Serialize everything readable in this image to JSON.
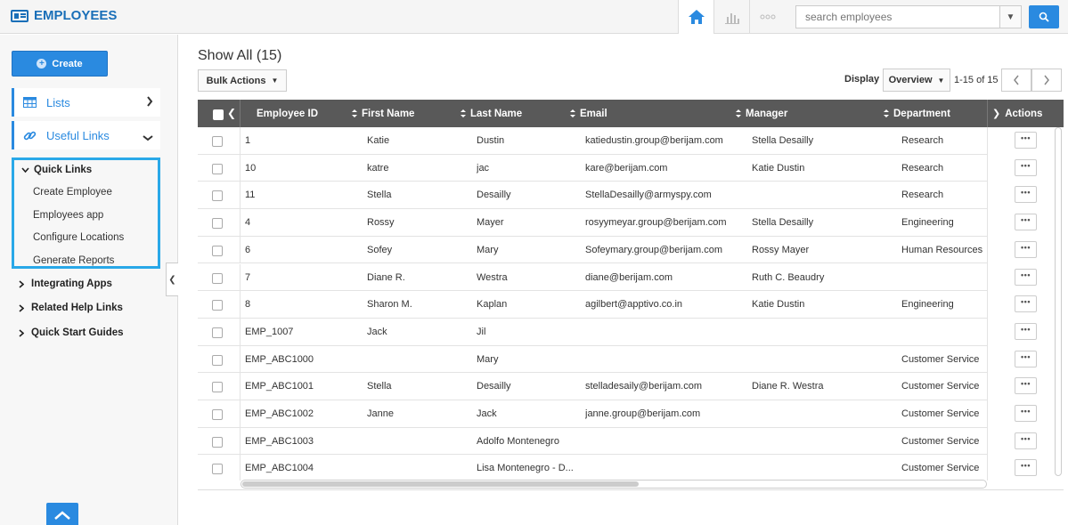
{
  "app": {
    "title": "EMPLOYEES"
  },
  "search": {
    "placeholder": "search employees"
  },
  "sidebar": {
    "create_label": "Create",
    "lists_label": "Lists",
    "useful_links_label": "Useful Links",
    "quick_links": {
      "title": "Quick Links",
      "items": [
        "Create Employee",
        "Employees app",
        "Configure Locations",
        "Generate Reports"
      ]
    },
    "groups": [
      "Integrating Apps",
      "Related Help Links",
      "Quick Start Guides"
    ]
  },
  "main": {
    "title": "Show All (15)",
    "bulk_actions": "Bulk Actions",
    "display_label": "Display",
    "display_value": "Overview",
    "pager_text": "1-15 of 15"
  },
  "table": {
    "columns": [
      "Employee ID",
      "First Name",
      "Last Name",
      "Email",
      "Manager",
      "Department",
      "Actions"
    ],
    "action_label": "•••",
    "rows": [
      [
        "1",
        "Katie",
        "Dustin",
        "katiedustin.group@berijam.com",
        "Stella Desailly",
        "Research"
      ],
      [
        "10",
        "katre",
        "jac",
        "kare@berijam.com",
        "Katie Dustin",
        "Research"
      ],
      [
        "11",
        "Stella",
        "Desailly",
        "StellaDesailly@armyspy.com",
        "",
        "Research"
      ],
      [
        "4",
        "Rossy",
        "Mayer",
        "rosyymeyar.group@berijam.com",
        "Stella Desailly",
        "Engineering"
      ],
      [
        "6",
        "Sofey",
        "Mary",
        "Sofeymary.group@berijam.com",
        "Rossy Mayer",
        "Human Resources"
      ],
      [
        "7",
        "Diane R.",
        "Westra",
        "diane@berijam.com",
        "Ruth C. Beaudry",
        ""
      ],
      [
        "8",
        "Sharon M.",
        "Kaplan",
        "agilbert@apptivo.co.in",
        "Katie Dustin",
        "Engineering"
      ],
      [
        "EMP_1007",
        "Jack",
        "Jil",
        "",
        "",
        ""
      ],
      [
        "EMP_ABC1000",
        "",
        "Mary",
        "",
        "",
        "Customer Service"
      ],
      [
        "EMP_ABC1001",
        "Stella",
        "Desailly",
        "stelladesaily@berijam.com",
        "Diane R. Westra",
        "Customer Service"
      ],
      [
        "EMP_ABC1002",
        "Janne",
        "Jack",
        "janne.group@berijam.com",
        "",
        "Customer Service"
      ],
      [
        "EMP_ABC1003",
        "",
        "Adolfo Montenegro",
        "",
        "",
        "Customer Service"
      ],
      [
        "EMP_ABC1004",
        "",
        "Lisa Montenegro - D...",
        "",
        "",
        "Customer Service"
      ]
    ]
  },
  "colors": {
    "accent": "#2a8ae0",
    "header_bg": "#595959",
    "highlight": "#29a8e8"
  }
}
